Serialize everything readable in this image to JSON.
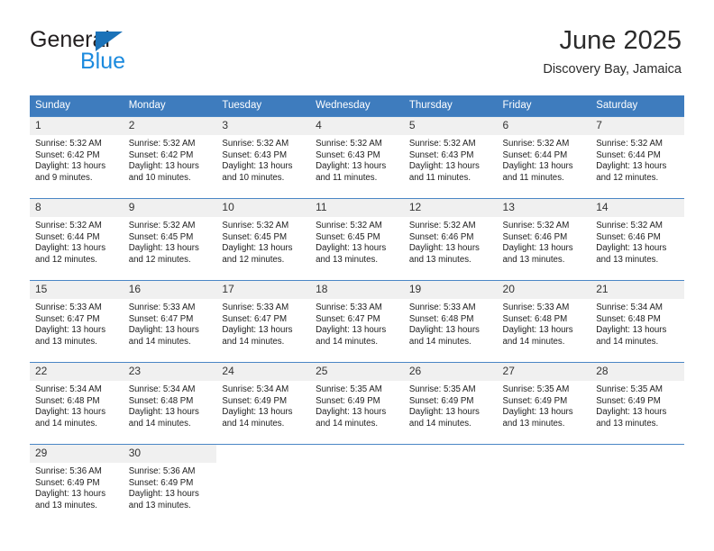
{
  "brand": {
    "name_dark": "General",
    "name_blue": "Blue",
    "triangle_color": "#1b72b8",
    "blue_color": "#1b8ade"
  },
  "header": {
    "title": "June 2025",
    "location": "Discovery Bay, Jamaica"
  },
  "theme": {
    "header_bg": "#3e7cbe",
    "daynum_bg": "#f0f0f0",
    "row_border": "#4a86c5"
  },
  "weekdays": [
    "Sunday",
    "Monday",
    "Tuesday",
    "Wednesday",
    "Thursday",
    "Friday",
    "Saturday"
  ],
  "labels": {
    "sunrise_prefix": "Sunrise:",
    "sunset_prefix": "Sunset:",
    "daylight_prefix": "Daylight:"
  },
  "days": [
    {
      "date": "1",
      "sunrise": "Sunrise: 5:32 AM",
      "sunset": "Sunset: 6:42 PM",
      "daylight": "Daylight: 13 hours and 9 minutes."
    },
    {
      "date": "2",
      "sunrise": "Sunrise: 5:32 AM",
      "sunset": "Sunset: 6:42 PM",
      "daylight": "Daylight: 13 hours and 10 minutes."
    },
    {
      "date": "3",
      "sunrise": "Sunrise: 5:32 AM",
      "sunset": "Sunset: 6:43 PM",
      "daylight": "Daylight: 13 hours and 10 minutes."
    },
    {
      "date": "4",
      "sunrise": "Sunrise: 5:32 AM",
      "sunset": "Sunset: 6:43 PM",
      "daylight": "Daylight: 13 hours and 11 minutes."
    },
    {
      "date": "5",
      "sunrise": "Sunrise: 5:32 AM",
      "sunset": "Sunset: 6:43 PM",
      "daylight": "Daylight: 13 hours and 11 minutes."
    },
    {
      "date": "6",
      "sunrise": "Sunrise: 5:32 AM",
      "sunset": "Sunset: 6:44 PM",
      "daylight": "Daylight: 13 hours and 11 minutes."
    },
    {
      "date": "7",
      "sunrise": "Sunrise: 5:32 AM",
      "sunset": "Sunset: 6:44 PM",
      "daylight": "Daylight: 13 hours and 12 minutes."
    },
    {
      "date": "8",
      "sunrise": "Sunrise: 5:32 AM",
      "sunset": "Sunset: 6:44 PM",
      "daylight": "Daylight: 13 hours and 12 minutes."
    },
    {
      "date": "9",
      "sunrise": "Sunrise: 5:32 AM",
      "sunset": "Sunset: 6:45 PM",
      "daylight": "Daylight: 13 hours and 12 minutes."
    },
    {
      "date": "10",
      "sunrise": "Sunrise: 5:32 AM",
      "sunset": "Sunset: 6:45 PM",
      "daylight": "Daylight: 13 hours and 12 minutes."
    },
    {
      "date": "11",
      "sunrise": "Sunrise: 5:32 AM",
      "sunset": "Sunset: 6:45 PM",
      "daylight": "Daylight: 13 hours and 13 minutes."
    },
    {
      "date": "12",
      "sunrise": "Sunrise: 5:32 AM",
      "sunset": "Sunset: 6:46 PM",
      "daylight": "Daylight: 13 hours and 13 minutes."
    },
    {
      "date": "13",
      "sunrise": "Sunrise: 5:32 AM",
      "sunset": "Sunset: 6:46 PM",
      "daylight": "Daylight: 13 hours and 13 minutes."
    },
    {
      "date": "14",
      "sunrise": "Sunrise: 5:32 AM",
      "sunset": "Sunset: 6:46 PM",
      "daylight": "Daylight: 13 hours and 13 minutes."
    },
    {
      "date": "15",
      "sunrise": "Sunrise: 5:33 AM",
      "sunset": "Sunset: 6:47 PM",
      "daylight": "Daylight: 13 hours and 13 minutes."
    },
    {
      "date": "16",
      "sunrise": "Sunrise: 5:33 AM",
      "sunset": "Sunset: 6:47 PM",
      "daylight": "Daylight: 13 hours and 14 minutes."
    },
    {
      "date": "17",
      "sunrise": "Sunrise: 5:33 AM",
      "sunset": "Sunset: 6:47 PM",
      "daylight": "Daylight: 13 hours and 14 minutes."
    },
    {
      "date": "18",
      "sunrise": "Sunrise: 5:33 AM",
      "sunset": "Sunset: 6:47 PM",
      "daylight": "Daylight: 13 hours and 14 minutes."
    },
    {
      "date": "19",
      "sunrise": "Sunrise: 5:33 AM",
      "sunset": "Sunset: 6:48 PM",
      "daylight": "Daylight: 13 hours and 14 minutes."
    },
    {
      "date": "20",
      "sunrise": "Sunrise: 5:33 AM",
      "sunset": "Sunset: 6:48 PM",
      "daylight": "Daylight: 13 hours and 14 minutes."
    },
    {
      "date": "21",
      "sunrise": "Sunrise: 5:34 AM",
      "sunset": "Sunset: 6:48 PM",
      "daylight": "Daylight: 13 hours and 14 minutes."
    },
    {
      "date": "22",
      "sunrise": "Sunrise: 5:34 AM",
      "sunset": "Sunset: 6:48 PM",
      "daylight": "Daylight: 13 hours and 14 minutes."
    },
    {
      "date": "23",
      "sunrise": "Sunrise: 5:34 AM",
      "sunset": "Sunset: 6:48 PM",
      "daylight": "Daylight: 13 hours and 14 minutes."
    },
    {
      "date": "24",
      "sunrise": "Sunrise: 5:34 AM",
      "sunset": "Sunset: 6:49 PM",
      "daylight": "Daylight: 13 hours and 14 minutes."
    },
    {
      "date": "25",
      "sunrise": "Sunrise: 5:35 AM",
      "sunset": "Sunset: 6:49 PM",
      "daylight": "Daylight: 13 hours and 14 minutes."
    },
    {
      "date": "26",
      "sunrise": "Sunrise: 5:35 AM",
      "sunset": "Sunset: 6:49 PM",
      "daylight": "Daylight: 13 hours and 14 minutes."
    },
    {
      "date": "27",
      "sunrise": "Sunrise: 5:35 AM",
      "sunset": "Sunset: 6:49 PM",
      "daylight": "Daylight: 13 hours and 13 minutes."
    },
    {
      "date": "28",
      "sunrise": "Sunrise: 5:35 AM",
      "sunset": "Sunset: 6:49 PM",
      "daylight": "Daylight: 13 hours and 13 minutes."
    },
    {
      "date": "29",
      "sunrise": "Sunrise: 5:36 AM",
      "sunset": "Sunset: 6:49 PM",
      "daylight": "Daylight: 13 hours and 13 minutes."
    },
    {
      "date": "30",
      "sunrise": "Sunrise: 5:36 AM",
      "sunset": "Sunset: 6:49 PM",
      "daylight": "Daylight: 13 hours and 13 minutes."
    }
  ],
  "grid": {
    "leading_blanks": 0,
    "trailing_blanks": 5,
    "columns": 7
  }
}
